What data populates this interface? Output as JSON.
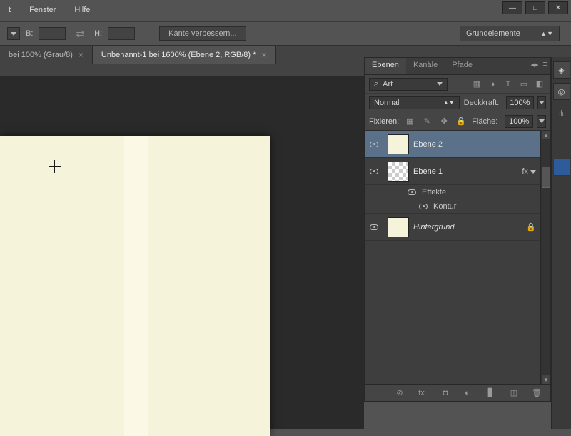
{
  "menu": {
    "items": [
      "t",
      "Fenster",
      "Hilfe"
    ]
  },
  "window_buttons": {
    "min": "—",
    "max": "□",
    "close": "✕"
  },
  "options_bar": {
    "w_label": "B:",
    "h_label": "H:",
    "refine_label": "Kante verbessern...",
    "preset_label": "Grundelemente"
  },
  "doc_tabs": [
    {
      "label": "bei 100% (Grau/8)",
      "active": false
    },
    {
      "label": "Unbenannt-1 bei 1600% (Ebene 2, RGB/8) *",
      "active": true
    }
  ],
  "panels": {
    "tabs": {
      "ebenen": "Ebenen",
      "kanale": "Kanäle",
      "pfade": "Pfade"
    },
    "flyout": {
      "collapse": "◂▸",
      "menu": "≡"
    },
    "filter": {
      "search_icon": "⌕",
      "label": "Art"
    },
    "filter_icons": [
      "▦",
      "◑",
      "T",
      "▭",
      "◧"
    ],
    "blend_mode": "Normal",
    "opacity_label": "Deckkraft:",
    "opacity_value": "100%",
    "lock_label": "Fixieren:",
    "lock_icons": [
      "▦",
      "✎",
      "✥",
      "🔒"
    ],
    "fill_label": "Fläche:",
    "fill_value": "100%",
    "layers": [
      {
        "name": "Ebene 2",
        "selected": true,
        "thumb": "solid"
      },
      {
        "name": "Ebene 1",
        "selected": false,
        "thumb": "checker",
        "fx": "fx",
        "effects": {
          "heading": "Effekte",
          "items": [
            "Kontur"
          ]
        }
      },
      {
        "name": "Hintergrund",
        "selected": false,
        "thumb": "solid",
        "italic": true,
        "locked": "🔒"
      }
    ],
    "footer_icons": [
      "⊘",
      "fx.",
      "◘",
      "◐.",
      "▋",
      "◫",
      "🗑"
    ]
  },
  "dock_icons": [
    "◈",
    "◎",
    "⋔",
    "■"
  ]
}
